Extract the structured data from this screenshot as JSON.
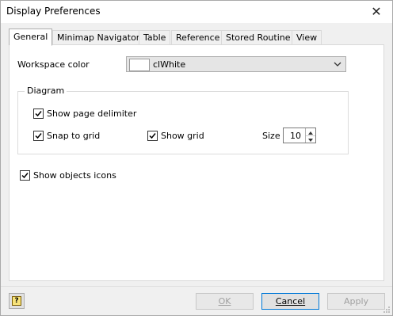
{
  "window": {
    "title": "Display Preferences"
  },
  "tabs": [
    {
      "label": "General",
      "active": true
    },
    {
      "label": "Minimap Navigator",
      "active": false
    },
    {
      "label": "Table",
      "active": false
    },
    {
      "label": "Reference",
      "active": false
    },
    {
      "label": "Stored Routine",
      "active": false
    },
    {
      "label": "View",
      "active": false
    }
  ],
  "general": {
    "workspace_color_label": "Workspace color",
    "workspace_color_value": "clWhite",
    "workspace_color_swatch": "#ffffff",
    "diagram_group_label": "Diagram",
    "show_page_delimiter": {
      "label": "Show page delimiter",
      "checked": true
    },
    "snap_to_grid": {
      "label": "Snap to grid",
      "checked": true
    },
    "show_grid": {
      "label": "Show grid",
      "checked": true
    },
    "size_label": "Size",
    "size_value": "10",
    "show_objects_icons": {
      "label": "Show objects icons",
      "checked": true
    }
  },
  "footer": {
    "help_icon": "help-icon",
    "ok_label": "OK",
    "cancel_label": "Cancel",
    "apply_label": "Apply"
  },
  "colors": {
    "accent": "#0078d7",
    "window_bg": "#f0f0f0",
    "panel_bg": "#ffffff"
  }
}
